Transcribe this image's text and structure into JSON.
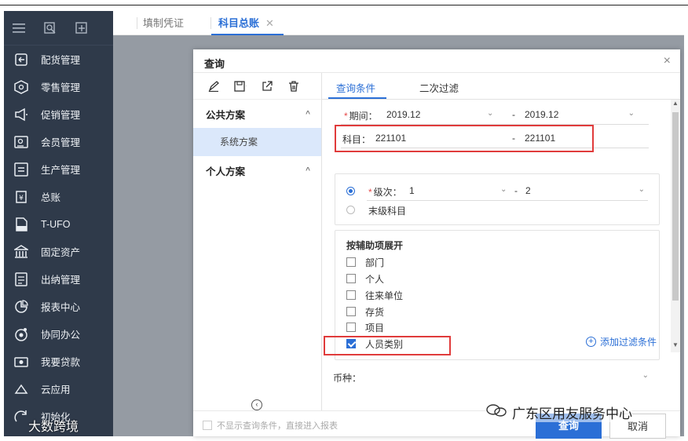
{
  "tabs": [
    {
      "label": "填制凭证",
      "active": false
    },
    {
      "label": "科目总账",
      "active": true,
      "close": "✕"
    }
  ],
  "sidebar": {
    "items": [
      {
        "label": "配货管理",
        "icon": "return-box-icon"
      },
      {
        "label": "零售管理",
        "icon": "retail-box-icon"
      },
      {
        "label": "促销管理",
        "icon": "megaphone-icon"
      },
      {
        "label": "会员管理",
        "icon": "member-card-icon"
      },
      {
        "label": "生产管理",
        "icon": "production-icon"
      },
      {
        "label": "总账",
        "icon": "ledger-icon"
      },
      {
        "label": "T-UFO",
        "icon": "ufo-document-icon"
      },
      {
        "label": "固定资产",
        "icon": "building-icon"
      },
      {
        "label": "出纳管理",
        "icon": "cashier-icon"
      },
      {
        "label": "报表中心",
        "icon": "report-icon"
      },
      {
        "label": "协同办公",
        "icon": "collaboration-icon"
      },
      {
        "label": "我要贷款",
        "icon": "loan-icon"
      },
      {
        "label": "云应用",
        "icon": "cloud-icon"
      },
      {
        "label": "初始化",
        "icon": "init-icon"
      }
    ]
  },
  "dialog": {
    "title": "查询",
    "close": "×",
    "left": {
      "public_group": "公共方案",
      "public_item": "系统方案",
      "personal_group": "个人方案",
      "chev": "^"
    },
    "tabs": {
      "conditions": "查询条件",
      "secondary": "二次过滤"
    },
    "period": {
      "label": "期间：",
      "from": "2019.12",
      "to": "2019.12"
    },
    "subject": {
      "label": "科目：",
      "from": "221101",
      "to": "221101"
    },
    "level": {
      "label": "级次：",
      "from": "1",
      "to": "2",
      "leaf_label": "末级科目"
    },
    "aux": {
      "title": "按辅助项展开",
      "items": [
        {
          "label": "部门",
          "checked": false
        },
        {
          "label": "个人",
          "checked": false
        },
        {
          "label": "往来单位",
          "checked": false
        },
        {
          "label": "存货",
          "checked": false
        },
        {
          "label": "项目",
          "checked": false
        },
        {
          "label": "人员类别",
          "checked": true
        }
      ]
    },
    "currency": {
      "label": "币种："
    },
    "add_filter": "添加过滤条件",
    "footer": {
      "skip_label": "不显示查询条件，直接进入报表",
      "query": "查询",
      "cancel": "取消"
    },
    "symbols": {
      "req": "*",
      "dash": "-",
      "dd": "⌄"
    }
  },
  "watermark": {
    "text": "广东区用友服务中心",
    "left_text": "大数跨境"
  },
  "colors": {
    "accent": "#2b6fd6",
    "sidebar": "#2f3a4a",
    "highlight": "#e03b3b"
  }
}
